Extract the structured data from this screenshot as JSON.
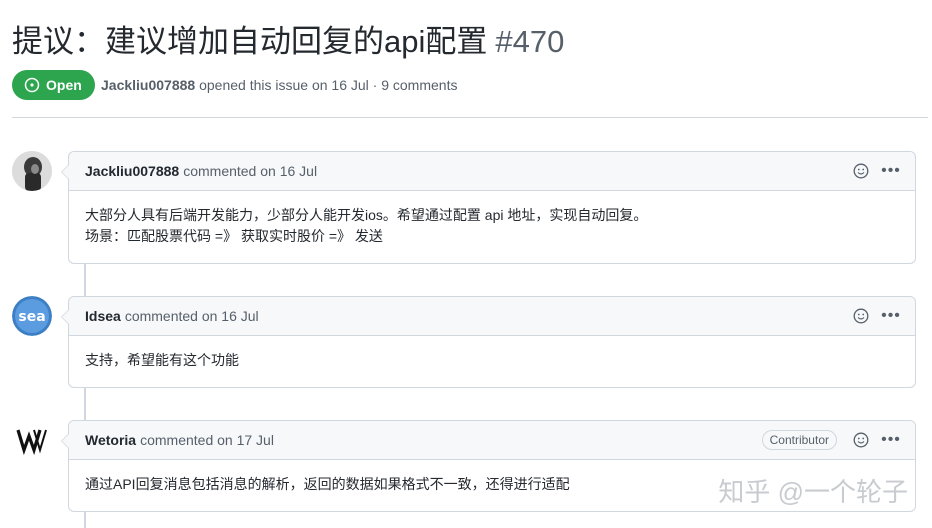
{
  "issue": {
    "title": "提议：建议增加自动回复的api配置",
    "number": "#470",
    "state": "Open",
    "author": "Jackliu007888",
    "meta_text": "opened this issue on 16 Jul · 9 comments"
  },
  "comments": [
    {
      "author": "Jackliu007888",
      "action": "commented on 16 Jul",
      "role": "",
      "lines": [
        "大部分人具有后端开发能力，少部分人能开发ios。希望通过配置 api 地址，实现自动回复。",
        "场景：匹配股票代码 =》 获取实时股价 =》 发送"
      ]
    },
    {
      "author": "Idsea",
      "action": "commented on 16 Jul",
      "role": "",
      "lines": [
        "支持，希望能有这个功能"
      ]
    },
    {
      "author": "Wetoria",
      "action": "commented on 17 Jul",
      "role": "Contributor",
      "lines": [
        "通过API回复消息包括消息的解析，返回的数据如果格式不一致，还得进行适配"
      ]
    }
  ],
  "watermark": "知乎 @一个轮子",
  "colors": {
    "open_green": "#2da44e",
    "border": "#d0d7de",
    "header_bg": "#f6f8fa",
    "muted": "#57606a"
  }
}
